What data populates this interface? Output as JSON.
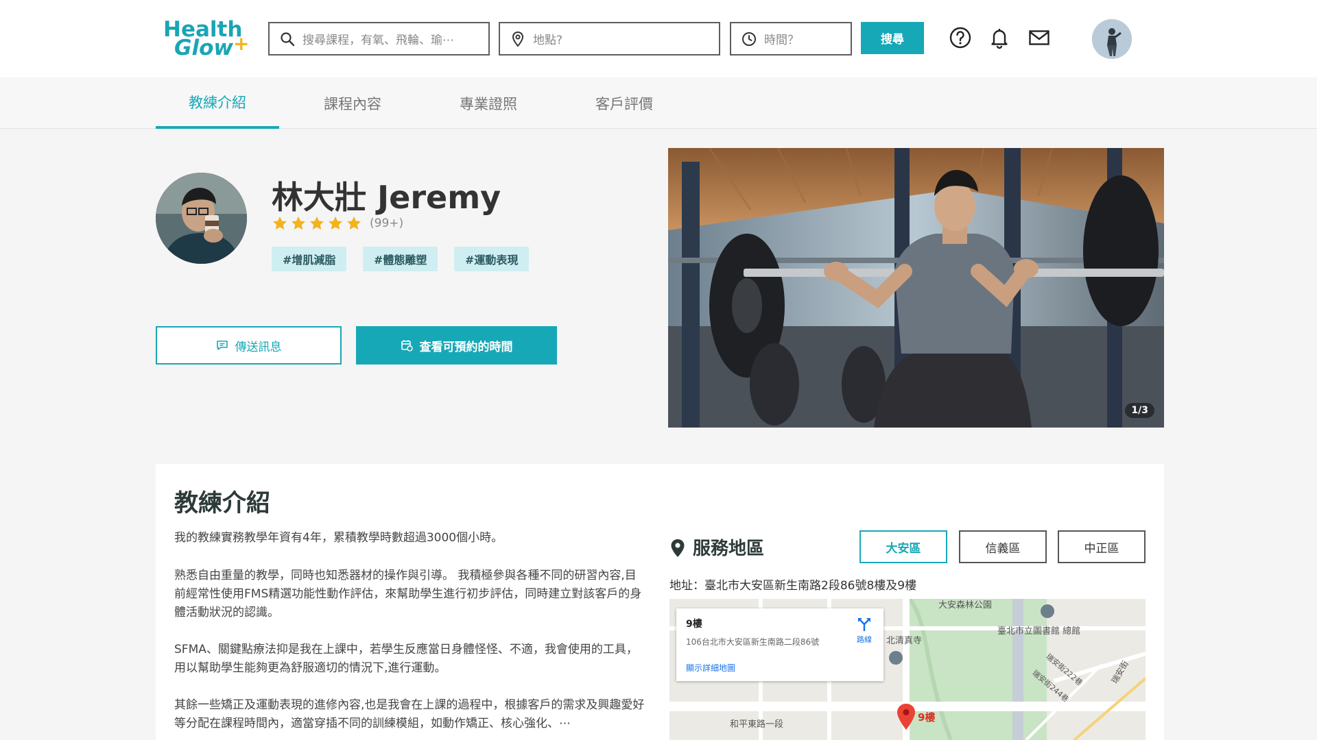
{
  "header": {
    "logo_line1": "Health",
    "logo_line2": "Glow",
    "logo_plus": "+",
    "search_placeholder": "搜尋課程，有氧、飛輪、瑜⋯",
    "location_placeholder": "地點?",
    "time_placeholder": "時間？",
    "search_button": "搜尋",
    "icons": [
      "search-icon",
      "location-pin-icon",
      "clock-icon",
      "help-icon",
      "bell-icon",
      "mail-icon"
    ]
  },
  "tabs": [
    {
      "label": "教練介紹",
      "active": true
    },
    {
      "label": "課程內容",
      "active": false
    },
    {
      "label": "專業證照",
      "active": false
    },
    {
      "label": "客戶評價",
      "active": false
    }
  ],
  "profile": {
    "name": "林大壯 Jeremy",
    "rating_stars": 5,
    "rating_count": "(99+)",
    "tags": [
      "#增肌減脂",
      "#體態雕塑",
      "#運動表現"
    ],
    "message_button": "傳送訊息",
    "booking_button": "查看可預約的時間"
  },
  "hero": {
    "counter": "1/3"
  },
  "intro": {
    "title": "教練介紹",
    "paragraphs": [
      "我的教練實務教學年資有4年，累積教學時數超過3000個小時。",
      "熟悉自由重量的教學，同時也知悉器材的操作與引導。 我積極參與各種不同的研習內容,目前經常性使用FMS精選功能性動作評估，來幫助學生進行初步評估，同時建立對該客戶的身體活動狀況的認識。",
      "SFMA、關鍵點療法抑是我在上課中，若學生反應當日身體怪怪、不適，我會使用的工具，用以幫助學生能夠更為舒服適切的情況下,進行運動。",
      "其餘一些矯正及運動表現的進修內容,也是我會在上課的過程中，根據客戶的需求及興趣愛好等分配在課程時間內，適當穿插不同的訓練模組，如動作矯正、核心強化、⋯"
    ]
  },
  "service": {
    "title": "服務地區",
    "areas": [
      {
        "label": "大安區",
        "active": true
      },
      {
        "label": "信義區",
        "active": false
      },
      {
        "label": "中正區",
        "active": false
      }
    ],
    "address": "地址：臺北市大安區新生南路2段86號8樓及9樓"
  },
  "map": {
    "place_name": "9樓",
    "place_address": "106台北市大安區新生南路二段86號",
    "directions_label": "路線",
    "larger_map_link": "顯示詳細地圖",
    "labels": [
      "大安森林公園",
      "臺北市立圖書館 總館",
      "北清真寺",
      "和平東路一段",
      "瑞安街222巷",
      "瑞安街244巷",
      "瑞安街"
    ],
    "pin_label": "9樓"
  },
  "colors": {
    "accent": "#17a8b7",
    "tag_bg": "#cfeef1",
    "star": "#f3b31c",
    "logo": "#1aa5b5"
  }
}
